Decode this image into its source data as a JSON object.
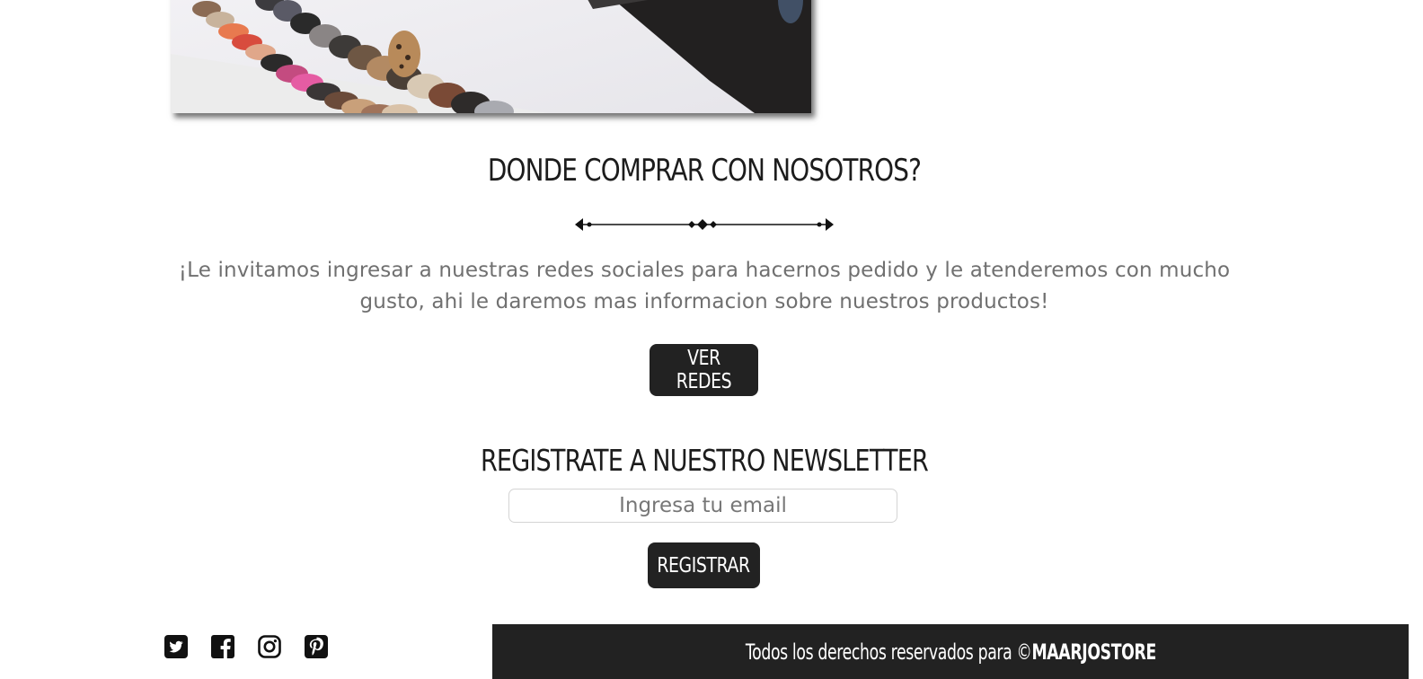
{
  "hero": {
    "image_alt": "shoe-collection-shelf-photo"
  },
  "buy_section": {
    "title": "DONDE COMPRAR CON NOSOTROS?",
    "text": "¡Le invitamos ingresar a nuestras redes sociales para hacernos pedido y le atenderemos con mucho gusto, ahi le daremos mas informacion sobre nuestros productos!",
    "button_label": "VER REDES"
  },
  "newsletter": {
    "title": "REGISTRATE A NUESTRO NEWSLETTER",
    "email_placeholder": "Ingresa tu email",
    "button_label": "REGISTRAR"
  },
  "footer": {
    "social_icons": [
      "twitter-icon",
      "facebook-icon",
      "instagram-icon",
      "pinterest-icon"
    ],
    "rights_text": "Todos los derechos reservados para ©",
    "brand": "MAARJOSTORE"
  },
  "colors": {
    "dark": "#222222",
    "text_gray": "#707070",
    "background": "#ffffff"
  }
}
